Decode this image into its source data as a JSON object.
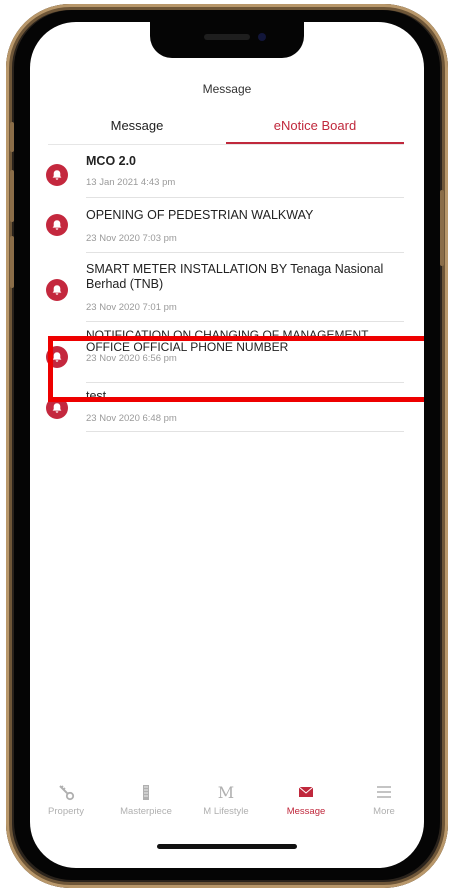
{
  "header": {
    "title": "Message"
  },
  "tabs": [
    {
      "label": "Message",
      "active": false
    },
    {
      "label": "eNotice Board",
      "active": true
    }
  ],
  "notices": [
    {
      "title": "MCO 2.0",
      "date": "13 Jan 2021 4:43 pm"
    },
    {
      "title": "OPENING OF PEDESTRIAN WALKWAY",
      "date": "23 Nov 2020 7:03 pm"
    },
    {
      "title": "SMART METER INSTALLATION BY Tenaga Nasional Berhad (TNB)",
      "date": "23 Nov 2020 7:01 pm"
    },
    {
      "title": "NOTIFICATION ON CHANGING OF MANAGEMENT OFFICE OFFICIAL PHONE NUMBER",
      "date": "23 Nov 2020 6:56 pm"
    },
    {
      "title": "test",
      "date": "23 Nov 2020 6:48 pm"
    }
  ],
  "bottom_nav": [
    {
      "label": "Property",
      "icon": "key-icon",
      "active": false
    },
    {
      "label": "Masterpiece",
      "icon": "building-icon",
      "active": false
    },
    {
      "label": "M Lifestyle",
      "icon": "m-logo-icon",
      "active": false
    },
    {
      "label": "Message",
      "icon": "envelope-icon",
      "active": true
    },
    {
      "label": "More",
      "icon": "menu-icon",
      "active": false
    }
  ],
  "colors": {
    "accent": "#c0283c",
    "highlight": "#ee0000",
    "inactive": "#b0b0b0"
  }
}
